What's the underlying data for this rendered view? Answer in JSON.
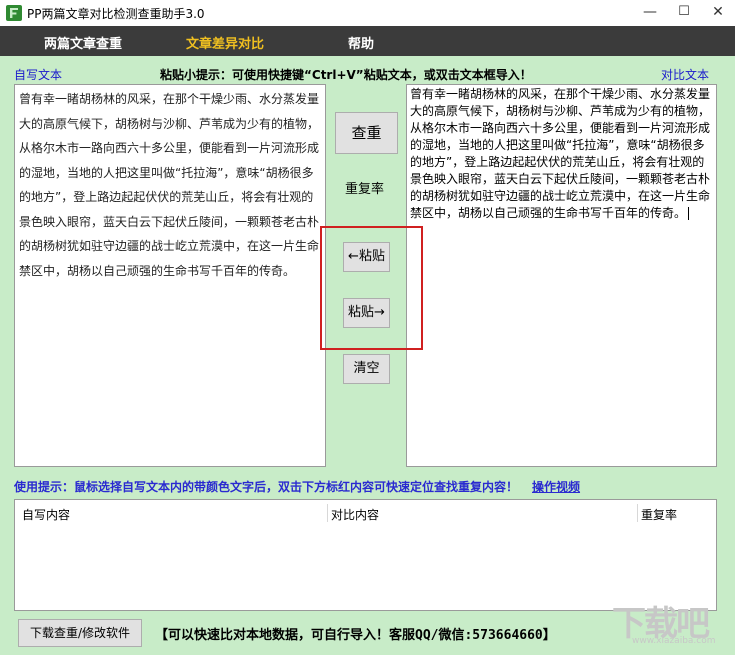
{
  "window": {
    "title": "PP两篇文章对比检测查重助手3.0",
    "minimize": "—",
    "maximize": "☐",
    "close": "✕"
  },
  "menu": {
    "items": [
      {
        "label": "两篇文章查重",
        "active": false
      },
      {
        "label": "文章差异对比",
        "active": true
      },
      {
        "label": "帮助",
        "active": false
      }
    ]
  },
  "labels": {
    "own_text": "自写文本",
    "paste_hint": "粘贴小提示：可使用快捷键“Ctrl+V”粘贴文本，或双击文本框导入！",
    "compare_text": "对比文本",
    "repeat_rate": "重复率"
  },
  "left_text": "曾有幸一睹胡杨林的风采，在那个干燥少雨、水分蒸发量大的高原气候下，胡杨树与沙柳、芦苇成为少有的植物，从格尔木市一路向西六十多公里，便能看到一片河流形成的湿地，当地的人把这里叫做“托拉海”，意味“胡杨很多的地方”，登上路边起起伏伏的荒芜山丘，将会有壮观的景色映入眼帘，蓝天白云下起伏丘陵间，一颗颗苍老古朴的胡杨树犹如驻守边疆的战士屹立荒漠中，在这一片生命禁区中，胡杨以自己顽强的生命书写千百年的传奇。",
  "right_text": "曾有幸一睹胡杨林的风采，在那个干燥少雨、水分蒸发量大的高原气候下，胡杨树与沙柳、芦苇成为少有的植物，从格尔木市一路向西六十多公里，便能看到一片河流形成的湿地，当地的人把这里叫做“托拉海”，意味“胡杨很多的地方”，登上路边起起伏伏的荒芜山丘，将会有壮观的景色映入眼帘，蓝天白云下起伏丘陵间，一颗颗苍老古朴的胡杨树犹如驻守边疆的战士屹立荒漠中，在这一片生命禁区中，胡杨以自己顽强的生命书写千百年的传奇。",
  "buttons": {
    "check": "查重",
    "paste_left": "←粘贴",
    "paste_right": "粘贴→",
    "clear": "清空",
    "download": "下载查重/修改软件"
  },
  "tip": {
    "text": "使用提示：鼠标选择自写文本内的带颜色文字后，双击下方标红内容可快速定位查找重复内容！",
    "link": "操作视频"
  },
  "table": {
    "columns": [
      "自写内容",
      "对比内容",
      "重复率"
    ],
    "rows": []
  },
  "bottom_note": "【可以快速比对本地数据，可自行导入！客服QQ/微信:573664660】",
  "watermark": {
    "main": "下载吧",
    "sub": "www.xiazaiba.com"
  },
  "colors": {
    "background": "#c8ecc8",
    "menubar": "#3b3b3b",
    "menu_active": "#f0c020",
    "highlight_box": "#d02020",
    "link_blue": "#1a1acc"
  }
}
